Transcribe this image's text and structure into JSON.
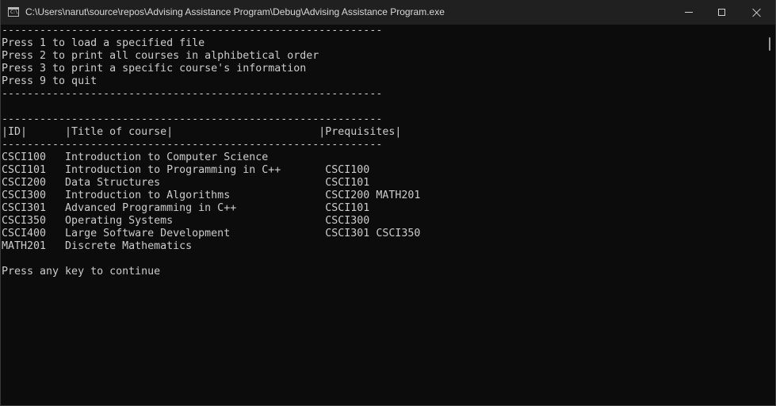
{
  "window": {
    "title": "C:\\Users\\narut\\source\\repos\\Advising Assistance Program\\Debug\\Advising Assistance Program.exe",
    "icon_label": "C:\\",
    "icon_name": "console-app-icon"
  },
  "console": {
    "lines": [
      "------------------------------------------------------------",
      "Press 1 to load a specified file",
      "Press 2 to print all courses in alphibetical order",
      "Press 3 to print a specific course's information",
      "Press 9 to quit",
      "------------------------------------------------------------",
      "",
      "------------------------------------------------------------",
      "|ID|      |Title of course|                       |Prequisites|",
      "------------------------------------------------------------",
      "CSCI100   Introduction to Computer Science",
      "CSCI101   Introduction to Programming in C++       CSCI100",
      "CSCI200   Data Structures                          CSCI101",
      "CSCI300   Introduction to Algorithms               CSCI200 MATH201",
      "CSCI301   Advanced Programming in C++              CSCI101",
      "CSCI350   Operating Systems                        CSCI300",
      "CSCI400   Large Software Development               CSCI301 CSCI350",
      "MATH201   Discrete Mathematics",
      "",
      "Press any key to continue"
    ]
  },
  "colors": {
    "titlebar_bg": "#202020",
    "console_bg": "#0c0c0c",
    "console_text": "#cccccc"
  }
}
